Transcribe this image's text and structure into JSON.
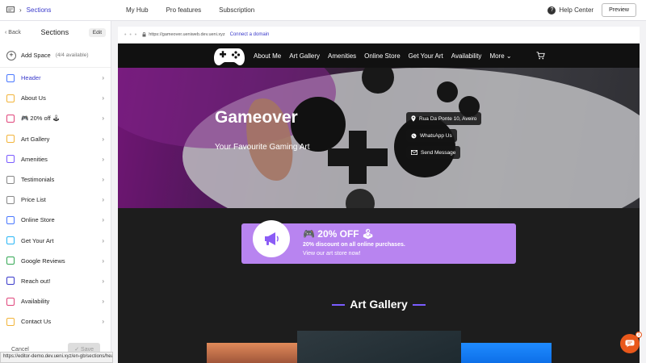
{
  "topbar": {
    "section_label": "Sections",
    "nav": [
      "My Hub",
      "Pro features",
      "Subscription"
    ],
    "help_label": "Help Center",
    "preview_label": "Preview"
  },
  "sidebar": {
    "back_label": "Back",
    "title": "Sections",
    "edit_label": "Edit",
    "add_label": "Add Space",
    "add_avail": "(4/4 available)",
    "items": [
      {
        "label": "Header",
        "color": "#4a78ff"
      },
      {
        "label": "About Us",
        "color": "#f2b43a"
      },
      {
        "label": "🎮 20% off 🕹",
        "color": "#e0457b"
      },
      {
        "label": "Art Gallery",
        "color": "#f2b43a"
      },
      {
        "label": "Amenities",
        "color": "#7a5cff"
      },
      {
        "label": "Testimonials",
        "color": "#888888"
      },
      {
        "label": "Price List",
        "color": "#888888"
      },
      {
        "label": "Online Store",
        "color": "#4a78ff"
      },
      {
        "label": "Get Your Art",
        "color": "#29b6f6"
      },
      {
        "label": "Google Reviews",
        "color": "#34a853"
      },
      {
        "label": "Reach out!",
        "color": "#3a3acb"
      },
      {
        "label": "Availability",
        "color": "#e0457b"
      },
      {
        "label": "Contact Us",
        "color": "#f2b43a"
      }
    ],
    "cancel_label": "Cancel",
    "save_label": "Save"
  },
  "status_url": "https://editor-demo.dev.ueni.xyz/en-gb/sections/header",
  "browser": {
    "url": "https://gameover.ueniweb.dev.ueni.xyz",
    "connect_label": "Connect a domain"
  },
  "site": {
    "nav": [
      "About Me",
      "Art Gallery",
      "Amenities",
      "Online Store",
      "Get Your Art",
      "Availability",
      "More"
    ],
    "hero_title": "Gameover",
    "hero_subtitle": "Your Favourite Gaming Art",
    "address": "Rua Da Ponte 10, Aveiro",
    "whatsapp": "WhatsApp Us",
    "send_message": "Send Message",
    "promo_title": "🎮 20% OFF 🕹",
    "promo_line1": "20% discount on all online purchases.",
    "promo_line2": "View our art store now!",
    "gallery_title": "Art Gallery"
  },
  "chat_badge": "1"
}
